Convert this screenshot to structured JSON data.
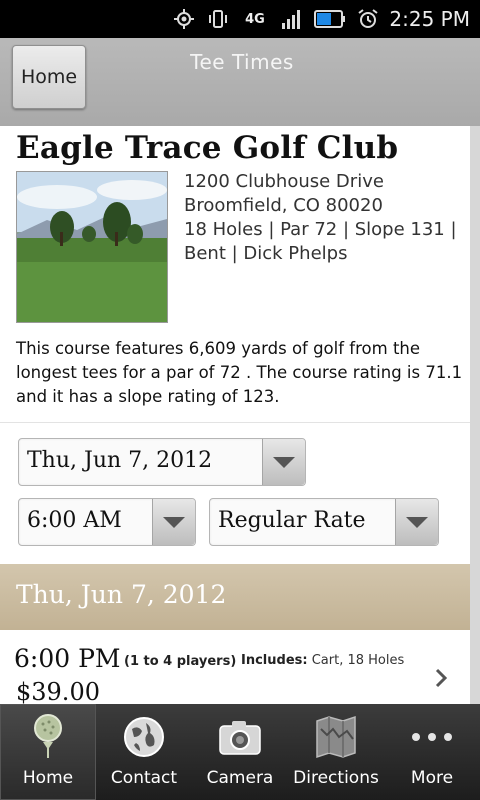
{
  "status_bar": {
    "time": "2:25 PM",
    "icons": [
      "gps-icon",
      "vibrate-icon",
      "4g-icon",
      "signal-icon",
      "battery-icon",
      "alarm-icon"
    ],
    "network_label": "4G"
  },
  "header": {
    "home_label": "Home",
    "title": "Tee Times"
  },
  "course": {
    "name": "Eagle Trace Golf Club",
    "address_line1": "1200 Clubhouse Drive",
    "address_line2": "Broomfield, CO 80020",
    "details_line1": "18 Holes | Par 72 | Slope 131 |",
    "details_line2": "Bent | Dick Phelps",
    "description": "This course features 6,609 yards of golf from the longest tees for a par of 72 . The course rating is 71.1 and it has a slope rating of 123."
  },
  "filters": {
    "date": "Thu, Jun 7, 2012",
    "time": "6:00 AM",
    "rate": "Regular Rate"
  },
  "results": {
    "date_header": "Thu, Jun 7, 2012",
    "tee_times": [
      {
        "time": "6:00 PM",
        "players": "(1 to 4 players)",
        "includes_label": "Includes:",
        "includes": "Cart, 18 Holes",
        "price": "$39.00"
      }
    ]
  },
  "tabs": [
    {
      "label": "Home",
      "icon": "golf-ball-icon",
      "active": true
    },
    {
      "label": "Contact",
      "icon": "globe-icon",
      "active": false
    },
    {
      "label": "Camera",
      "icon": "camera-icon",
      "active": false
    },
    {
      "label": "Directions",
      "icon": "map-icon",
      "active": false
    },
    {
      "label": "More",
      "icon": "more-dots-icon",
      "active": false
    }
  ],
  "colors": {
    "header_bg": "#a9a9a9",
    "date_band": "#c8b898",
    "tabbar_bg": "#2b2b2b"
  }
}
